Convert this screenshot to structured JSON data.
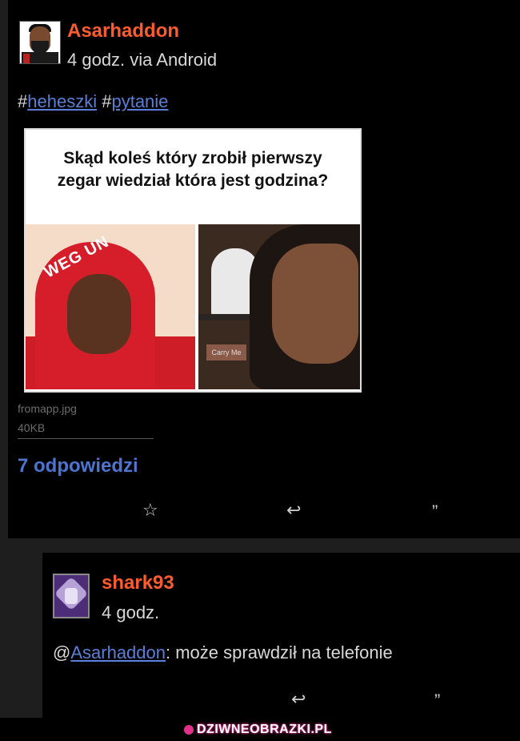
{
  "post": {
    "author": "Asarhaddon",
    "meta": "4 godz. via Android",
    "tags": [
      {
        "hash": "#",
        "label": "heheszki"
      },
      {
        "hash": "#",
        "label": "pytanie"
      }
    ],
    "image_caption_line1": "Skąd koleś który zrobił pierwszy",
    "image_caption_line2": "zegar wiedział która jest godzina?",
    "image_text_hood": "WEG UN",
    "image_text_sign": "Carry Me",
    "file_name": "fromapp.jpg",
    "file_size": "40KB",
    "replies_label": "7 odpowiedzi",
    "actions": {
      "star_icon": "☆",
      "reply_icon": "↩",
      "quote_icon": "”"
    }
  },
  "reply": {
    "author": "shark93",
    "meta": "4 godz.",
    "mention": "Asarhaddon",
    "mention_prefix": "@",
    "text": ": może sprawdził na telefonie",
    "actions": {
      "reply_icon": "↩",
      "quote_icon": "”"
    }
  },
  "watermark": "DZIWNEOBRAZKI.PL",
  "colors": {
    "username": "#ff5c2e",
    "link": "#4d74d1",
    "background": "#000000"
  }
}
